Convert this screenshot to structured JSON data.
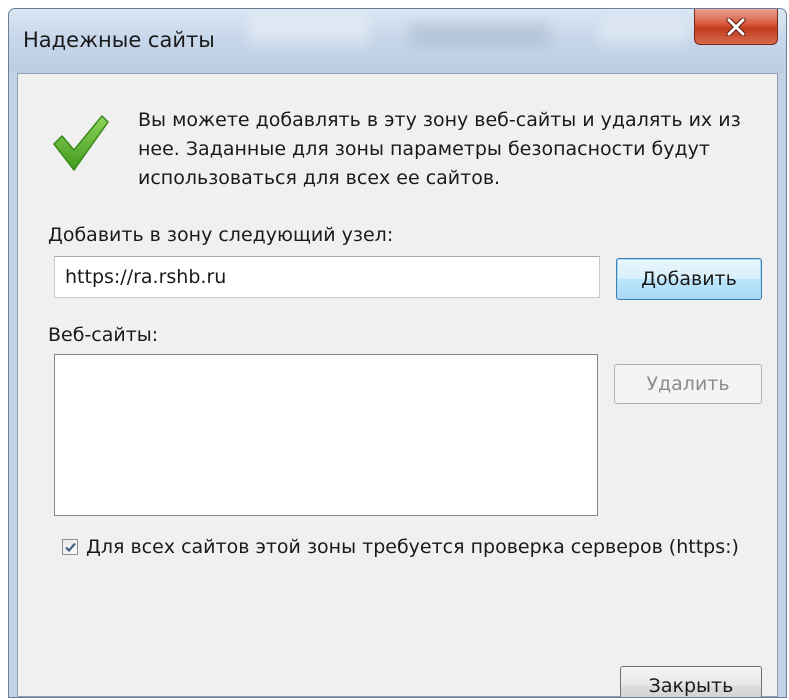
{
  "window": {
    "title": "Надежные сайты"
  },
  "intro_text": "Вы можете добавлять в эту зону веб-сайты и удалять их из нее. Заданные для зоны параметры безопасности будут использоваться для всех ее сайтов.",
  "add_zone": {
    "label": "Добавить в зону следующий узел:",
    "input_value": "https://ra.rshb.ru",
    "add_button": "Добавить"
  },
  "websites": {
    "label": "Веб-сайты:",
    "items": [],
    "remove_button": "Удалить"
  },
  "https_check": {
    "label": "Для всех сайтов этой зоны требуется проверка серверов (https:)",
    "checked": true
  },
  "close_button": "Закрыть",
  "icons": {
    "status": "checkmark-icon",
    "window_close": "close-icon"
  },
  "colors": {
    "close_button_red": "#c94a2f",
    "check_green": "#5cb030",
    "title_bar": "#c8d7ea"
  }
}
